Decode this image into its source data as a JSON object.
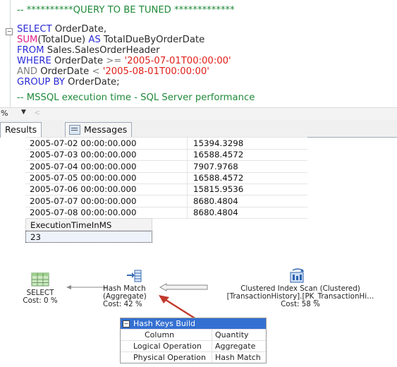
{
  "editor": {
    "comment1": "-- **********QUERY TO BE TUNED *************",
    "line1_kw": "SELECT",
    "line1_rest": " OrderDate,",
    "line2_fn": "SUM",
    "line2_p1": "(TotalDue) ",
    "line2_kw": "AS",
    "line2_rest": " TotalDueByOrderDate",
    "line3_kw": "FROM",
    "line3_rest": " Sales.SalesOrderHeader",
    "line4_kw": "WHERE",
    "line4_mid": " OrderDate ",
    "line4_op": ">=",
    "line4_str": " '2005-07-01T00:00:00'",
    "line5_kw": "AND",
    "line5_mid": " OrderDate ",
    "line5_op": "<",
    "line5_str": " '2005-08-01T00:00:00'",
    "line6_kw": "GROUP BY",
    "line6_rest": " OrderDate;",
    "comment2": "-- MSSQL execution time - SQL Server performance"
  },
  "zoom": {
    "value": "%",
    "arrow": "▼",
    "left": "<"
  },
  "tabs": {
    "results": "Results",
    "messages": "Messages"
  },
  "results_grid": {
    "rows": [
      [
        "2005-07-02 00:00:00.000",
        "15394.3298"
      ],
      [
        "2005-07-03 00:00:00.000",
        "16588.4572"
      ],
      [
        "2005-07-04 00:00:00.000",
        "7907.9768"
      ],
      [
        "2005-07-05 00:00:00.000",
        "16588.4572"
      ],
      [
        "2005-07-06 00:00:00.000",
        "15815.9536"
      ],
      [
        "2005-07-07 00:00:00.000",
        "8680.4804"
      ],
      [
        "2005-07-08 00:00:00.000",
        "8680.4804"
      ]
    ]
  },
  "timing_grid": {
    "header": "ExecutionTimeInMS",
    "value": "23"
  },
  "plan": {
    "select_label": "SELECT",
    "select_cost": "Cost: 0 %",
    "hash_label": "Hash Match",
    "hash_sub": "(Aggregate)",
    "hash_cost": "Cost: 42 %",
    "scan_label": "Clustered Index Scan (Clustered)",
    "scan_sub": "[TransactionHistory].[PK_TransactionHi…",
    "scan_cost": "Cost: 58 %"
  },
  "properties": {
    "header": "Hash Keys Build",
    "rows": [
      {
        "key": "Column",
        "value": "Quantity"
      },
      {
        "key": "Logical Operation",
        "value": "Aggregate"
      },
      {
        "key": "Physical Operation",
        "value": "Hash Match"
      }
    ]
  },
  "colors": {
    "keyword": "#2b2bd6",
    "function": "#e0218a",
    "string": "#e0201a",
    "comment": "#1f8a3a",
    "arrow": "#c0392b"
  }
}
